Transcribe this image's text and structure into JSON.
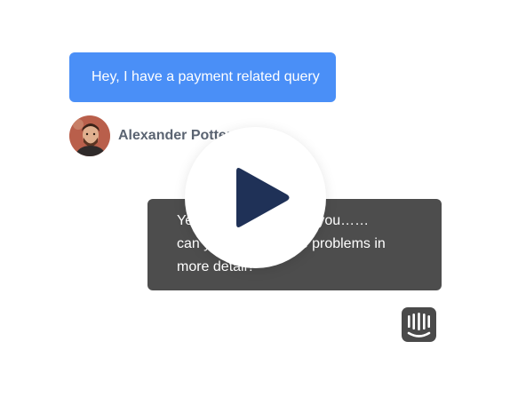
{
  "conversation": {
    "user_message": "Hey, I have a payment related query",
    "agent": {
      "name": "Alexander Potter",
      "avatar": "agent-photo"
    },
    "agent_reply_lines": [
      "Yes, of course. Thank you……",
      "can you describe the problems in",
      "more detail?"
    ]
  },
  "video": {
    "play_icon": "play-icon"
  },
  "branding": {
    "logo": "intercom-logo"
  },
  "colors": {
    "user_bubble": "#4a8ff7",
    "reply_bubble": "#4d4d4d",
    "agent_name": "#5b6472",
    "play_icon": "#1f3157",
    "logo": "#4a4a4a"
  }
}
